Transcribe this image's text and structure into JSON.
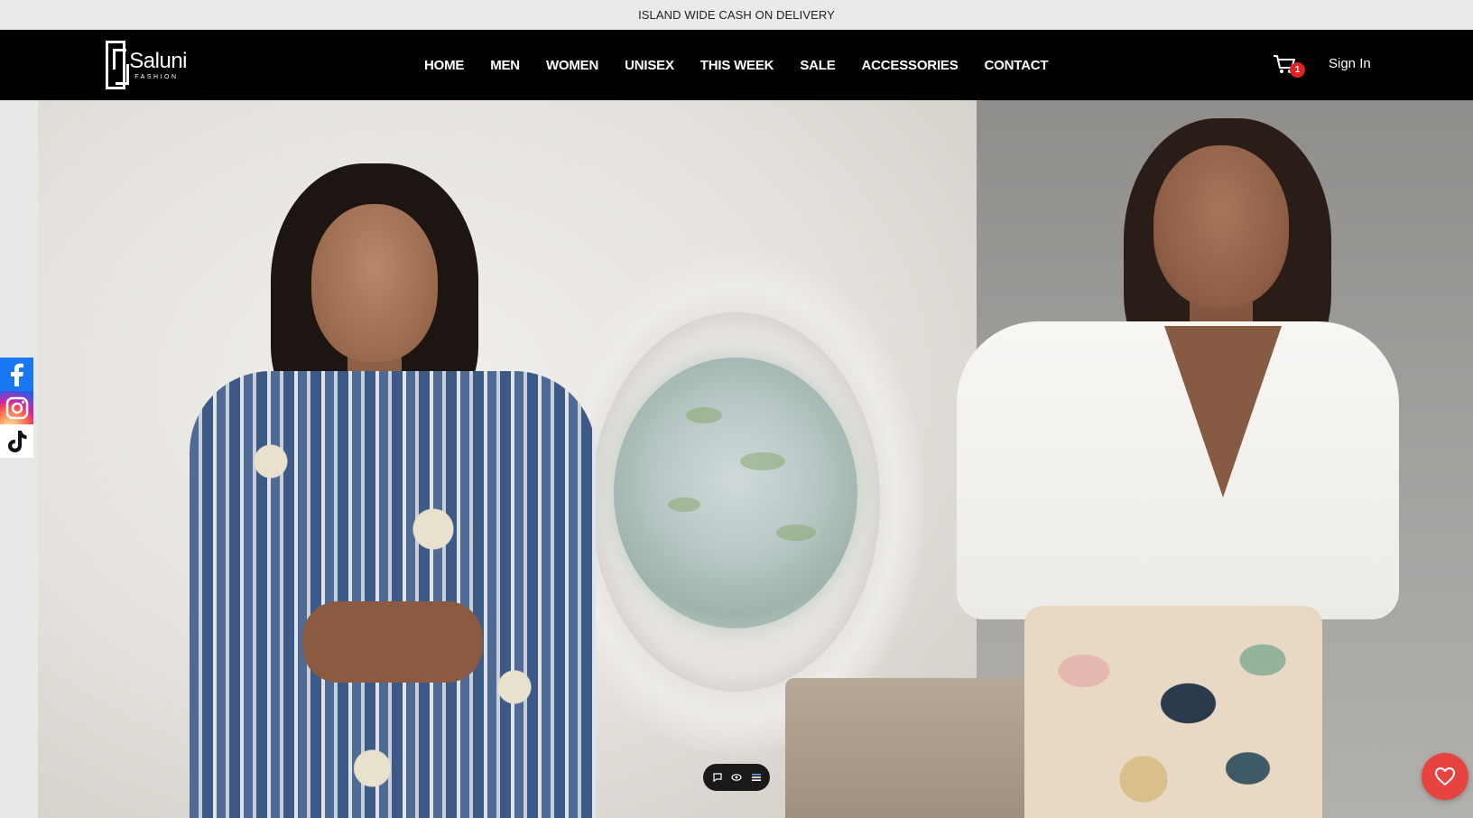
{
  "announcement": {
    "text": "ISLAND WIDE CASH ON DELIVERY"
  },
  "brand": {
    "name": "Saluni",
    "tagline": "FASHION"
  },
  "nav": {
    "items": [
      {
        "label": "HOME"
      },
      {
        "label": "MEN"
      },
      {
        "label": "WOMEN"
      },
      {
        "label": "UNISEX"
      },
      {
        "label": "THIS WEEK"
      },
      {
        "label": "SALE"
      },
      {
        "label": "ACCESSORIES"
      },
      {
        "label": "CONTACT"
      }
    ]
  },
  "cart": {
    "icon": "cart-icon",
    "count": "1"
  },
  "account": {
    "signin_label": "Sign In"
  },
  "social": {
    "items": [
      {
        "icon": "facebook-icon"
      },
      {
        "icon": "instagram-icon"
      },
      {
        "icon": "tiktok-icon"
      }
    ]
  },
  "slider_controls": {
    "icons": [
      "chat-icon",
      "eye-icon",
      "list-icon"
    ]
  },
  "wishlist": {
    "icon": "heart-icon"
  },
  "colors": {
    "header_bg": "#000000",
    "announce_bg": "#e9eaec",
    "badge": "#e02424",
    "wishlist": "#e8443f",
    "facebook": "#1877f2"
  }
}
